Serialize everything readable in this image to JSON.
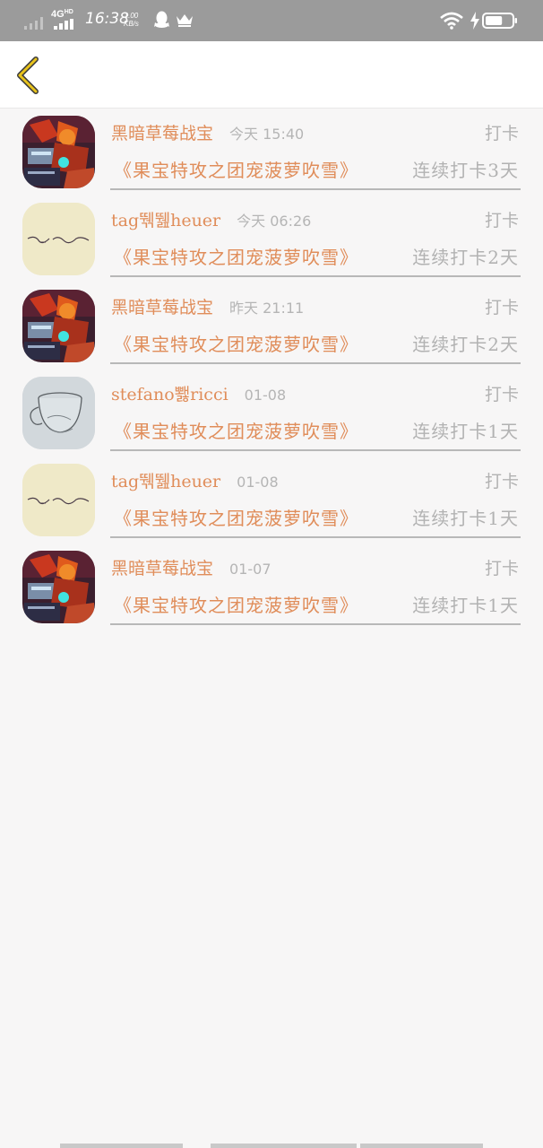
{
  "status_bar": {
    "network": "4G",
    "network_sup": "HD",
    "time": "16:38",
    "speed_value": "1.00",
    "speed_unit": "KB/s",
    "icons": [
      "signal-weak-icon",
      "signal-strong-icon",
      "qq-icon",
      "crown-icon",
      "wifi-icon",
      "charging-icon",
      "battery-icon"
    ],
    "battery_level": 0.65
  },
  "header": {
    "back_icon": "chevron-left-icon",
    "accent_color": "#e8c31c"
  },
  "colors": {
    "name": "#e08d5a",
    "muted": "#b2b2b2",
    "background": "#f7f6f6"
  },
  "checkins": [
    {
      "user": "黑暗草莓战宝",
      "time": "今天 15:40",
      "action": "打卡",
      "book": "《果宝特攻之团宠菠萝吹雪》",
      "streak": "连续打卡3天",
      "avatar": "robot"
    },
    {
      "user": "tag뛖뛢heuer",
      "time": "今天 06:26",
      "action": "打卡",
      "book": "《果宝特攻之团宠菠萝吹雪》",
      "streak": "连续打卡2天",
      "avatar": "note"
    },
    {
      "user": "黑暗草莓战宝",
      "time": "昨天 21:11",
      "action": "打卡",
      "book": "《果宝特攻之团宠菠萝吹雪》",
      "streak": "连续打卡2天",
      "avatar": "robot"
    },
    {
      "user": "stefano뾇ricci",
      "time": "01-08",
      "action": "打卡",
      "book": "《果宝特攻之团宠菠萝吹雪》",
      "streak": "连续打卡1天",
      "avatar": "glass"
    },
    {
      "user": "tag뛖뛢heuer",
      "time": "01-08",
      "action": "打卡",
      "book": "《果宝特攻之团宠菠萝吹雪》",
      "streak": "连续打卡1天",
      "avatar": "note"
    },
    {
      "user": "黑暗草莓战宝",
      "time": "01-07",
      "action": "打卡",
      "book": "《果宝特攻之团宠菠萝吹雪》",
      "streak": "连续打卡1天",
      "avatar": "robot"
    }
  ]
}
